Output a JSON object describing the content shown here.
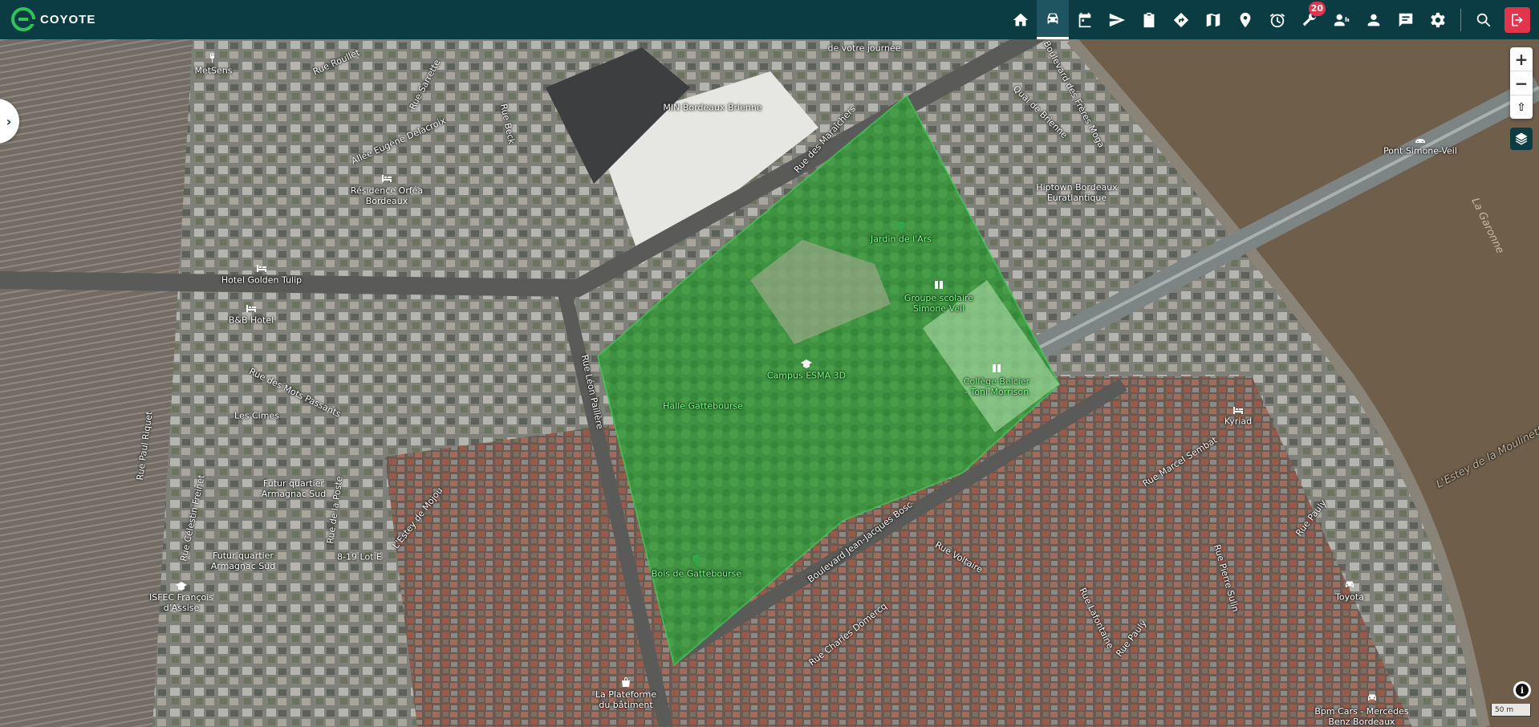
{
  "app": {
    "brand": "COYOTE",
    "accent": "#0b3c44",
    "alert": "#e3344d"
  },
  "nav": [
    {
      "icon": "home-icon"
    },
    {
      "icon": "car-icon",
      "active": true
    },
    {
      "icon": "calendar-icon"
    },
    {
      "icon": "send-icon"
    },
    {
      "icon": "clipboard-icon"
    },
    {
      "icon": "directions-icon"
    },
    {
      "icon": "map-icon"
    },
    {
      "icon": "location-pin-icon"
    },
    {
      "icon": "alarm-icon"
    },
    {
      "icon": "wrench-icon",
      "badge": "20"
    },
    {
      "icon": "users-icon"
    },
    {
      "icon": "person-icon"
    },
    {
      "icon": "chat-icon"
    },
    {
      "icon": "settings-icon"
    },
    {
      "icon": "search-icon"
    },
    {
      "icon": "logout-icon"
    }
  ],
  "map_controls": {
    "zoom_in": "+",
    "zoom_out": "−",
    "reset": "⇧",
    "scale": "50 m",
    "info": "i",
    "toggle": "›"
  },
  "places": [
    {
      "name": "MetSens"
    },
    {
      "name": "de votre journée"
    },
    {
      "name": "MIN Bordeaux Brienne"
    },
    {
      "name": "Résidence Orféa\nBordeaux"
    },
    {
      "name": "Hotel Golden Tulip"
    },
    {
      "name": "B&B Hotel"
    },
    {
      "name": "Jardin de l'Ars"
    },
    {
      "name": "Groupe scolaire\nSimone Veil"
    },
    {
      "name": "Hiptown Bordeaux\nEuratlantique"
    },
    {
      "name": "Pont Simone-Veil"
    },
    {
      "name": "Campus ESMA 3D"
    },
    {
      "name": "Collège Belcier\n- Toni Morrison"
    },
    {
      "name": "Halle Gattebourse"
    },
    {
      "name": "Les Cimes"
    },
    {
      "name": "Futur quartier\nArmagnac Sud"
    },
    {
      "name": "Futur quartier\nArmagnac Sud"
    },
    {
      "name": "8-19 Lot E"
    },
    {
      "name": "ISFEC François\nd'Assise"
    },
    {
      "name": "Bois de Gattebourse"
    },
    {
      "name": "La Plateforme\ndu bâtiment"
    },
    {
      "name": "Kyriad"
    },
    {
      "name": "Toyota"
    },
    {
      "name": "Bpm Cars - Mercedes\nBenz Bordeaux"
    }
  ],
  "streets": [
    "Rue Roullet",
    "Rue Sarrette",
    "Allée Eugène Delacroix",
    "Rue Beck",
    "Rue des Maraîchers",
    "Boulevard des Frères Moga",
    "Quai de Brienne",
    "Rue Léon Paillère",
    "Rue des Mots Passants",
    "Rue Paul Riquet",
    "Rue Célestin Freinet",
    "Rue de la Poste",
    "L'Estey de Mojou",
    "Boulevard Jean-Jacques Bosc",
    "Rue Voltaire",
    "Rue Charles Domercq",
    "Rue Lafontaine",
    "Rue Marcel Sembat",
    "Rue Pierre Sulin",
    "Rue Pauly",
    "Rue Pauly",
    "L'Estey de la Moulinette"
  ],
  "water": {
    "river": "La Garonne"
  }
}
